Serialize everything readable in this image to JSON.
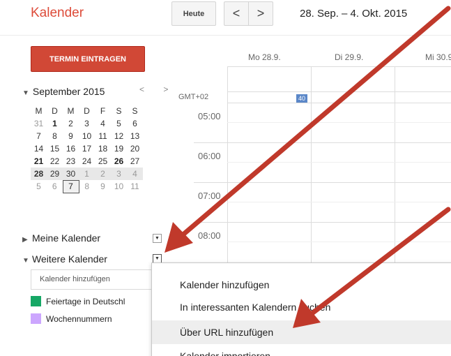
{
  "header": {
    "app_title": "Kalender",
    "today_label": "Heute",
    "prev_label": "<",
    "next_label": ">",
    "date_range": "28. Sep. – 4. Okt. 2015"
  },
  "sidebar": {
    "create_label_1": "TERMIN EINT",
    "create_label_2": "RAGEN",
    "mini_month": "September 2015",
    "mini_nav": "< >",
    "weekday_headers": [
      "M",
      "D",
      "M",
      "D",
      "F",
      "S",
      "S"
    ],
    "weeks": [
      [
        "31",
        "1",
        "2",
        "3",
        "4",
        "5",
        "6"
      ],
      [
        "7",
        "8",
        "9",
        "10",
        "11",
        "12",
        "13"
      ],
      [
        "14",
        "15",
        "16",
        "17",
        "18",
        "19",
        "20"
      ],
      [
        "21",
        "22",
        "23",
        "24",
        "25",
        "26",
        "27"
      ],
      [
        "28",
        "29",
        "30",
        "1",
        "2",
        "3",
        "4"
      ],
      [
        "5",
        "6",
        "7",
        "8",
        "9",
        "10",
        "11"
      ]
    ],
    "my_calendars_label": "Meine Kalender",
    "other_calendars_label": "Weitere Kalender",
    "add_calendar_placeholder": "Kalender hinzufügen",
    "calendars": [
      {
        "label": "Feiertage in Deutschl",
        "color": "#16a765"
      },
      {
        "label": "Wochennummern",
        "color": "#cca6fe"
      }
    ]
  },
  "grid": {
    "days": [
      "Mo 28.9.",
      "Di 29.9.",
      "Mi 30.9."
    ],
    "timezone_label": "GMT+02",
    "week_badge": "40",
    "hours": [
      "05:00",
      "06:00",
      "07:00",
      "08:00"
    ]
  },
  "dropdown_menu": {
    "items": [
      "Kalender hinzufügen",
      "In interessanten Kalendern suchen",
      "Über URL hinzufügen",
      "Kalender importieren"
    ],
    "highlighted_index": 2
  },
  "colors": {
    "brand_red": "#dd4b39",
    "create_button": "#d14836",
    "annotation_arrow": "#c0392b"
  }
}
